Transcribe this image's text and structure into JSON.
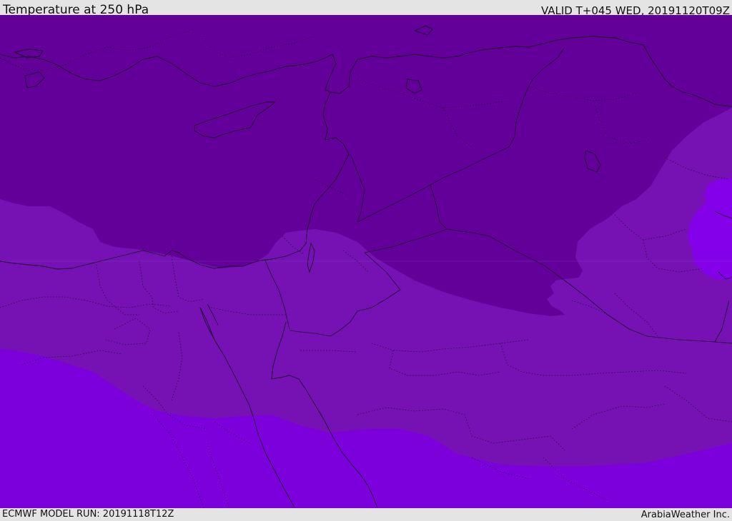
{
  "header": {
    "title": "Temperature at 250 hPa",
    "valid_time": "VALID T+045 WED, 20191120T09Z"
  },
  "footer": {
    "model_run": "ECMWF MODEL RUN: 20191118T12Z",
    "credit": "ArabiaWeather Inc."
  },
  "map": {
    "variable": "temperature",
    "pressure_level_hPa": 250,
    "colors": {
      "coldest_band": "#63009a",
      "mid_band": "#7612b4",
      "warm_band": "#7c00dc",
      "warmest_band": "#8400e8",
      "borders": "#1a0a2a"
    }
  }
}
